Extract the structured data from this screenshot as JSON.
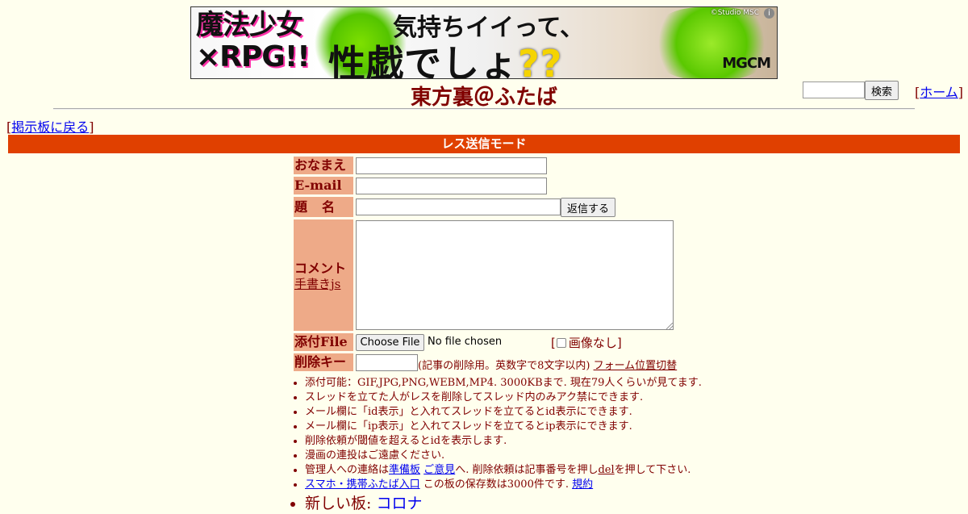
{
  "banner": {
    "left_line1": "魔法少女",
    "left_line2": "×RPG!!",
    "main_line1": "気持ちイイって、",
    "main_line2_prefix": "性戯でしょ",
    "main_line2_q": "??",
    "copyright": "©Studio MSC",
    "info": "i",
    "logo": "MGCM"
  },
  "header": {
    "board_title": "東方裏＠ふたば",
    "search_value": "",
    "search_button": "検索",
    "home_bracket_open": "[",
    "home_link": "ホーム",
    "home_bracket_close": "]"
  },
  "nav": {
    "back_open": "[",
    "back_link": "掲示板に戻る",
    "back_close": "]"
  },
  "form": {
    "mode_title": "レス送信モード",
    "name_label": "おなまえ",
    "email_label": "E-mail",
    "subject_label": "題名",
    "reply_button": "返信する",
    "comment_label": "コメント",
    "draw_link": "手書きjs",
    "file_label": "添付File",
    "file_button": "Choose File",
    "file_status": "No file chosen",
    "noimg_open": "[",
    "noimg_label": "画像なし]",
    "delkey_label": "削除キー",
    "delkey_note": "(記事の削除用。英数字で8文字以内)",
    "toggle_link": "フォーム位置切替",
    "name_value": "",
    "email_value": "",
    "subject_value": "",
    "comment_value": "",
    "delkey_value": ""
  },
  "notes": {
    "n1": "添付可能：GIF,JPG,PNG,WEBM,MP4. 3000KBまで. 現在79人くらいが見てます.",
    "n2": "スレッドを立てた人がレスを削除してスレッド内のみアク禁にできます.",
    "n3": "メール欄に「id表示」と入れてスレッドを立てるとid表示にできます.",
    "n4": "メール欄に「ip表示」と入れてスレッドを立てるとip表示にできます.",
    "n5": "削除依頼が閾値を超えるとidを表示します.",
    "n6": "漫画の連投はご遠慮ください.",
    "n7_prefix": "管理人への連絡は",
    "n7_link1": "準備板",
    "n7_link2": "ご意見",
    "n7_mid": "へ. 削除依頼は記事番号を押し",
    "n7_link3": "del",
    "n7_suffix": "を押して下さい.",
    "n8_link": "スマホ・携帯ふたば入口",
    "n8_mid": "この板の保存数は3000件です.",
    "n8_link2": "規約",
    "n9_prefix": "新しい板: ",
    "n9_link": "コロナ"
  }
}
